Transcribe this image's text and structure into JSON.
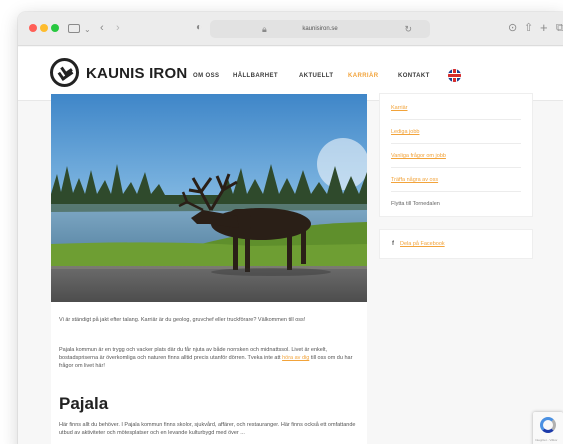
{
  "browser": {
    "url": "kaunisiron.se",
    "icons": [
      "sidebar-icon",
      "back-icon",
      "forward-icon",
      "shield-icon",
      "lock-icon",
      "reload-icon",
      "download-icon",
      "share-icon",
      "new-tab-icon",
      "tabs-icon"
    ]
  },
  "header": {
    "logo_text": "KAUNIS IRON",
    "nav": [
      "OM OSS",
      "HÅLLBARHET",
      "AKTUELLT",
      "KARRIÄR",
      "KONTAKT"
    ],
    "active_nav": "KARRIÄR",
    "language_flag": "UK flag"
  },
  "main": {
    "para1": "Vi är ständigt på jakt efter talang. Karriär är du geolog, gruvchef eller truckförare? Välkommen till oss!",
    "para2_start": "Pajala kommun är en trygg och vacker plats där du får njuta av både norrsken och midnattssol. Livet är enkelt, bostadspriserna är överkomliga och naturen finns alltid precis utanför dörren. Tveka inte att ",
    "para2_link": "höra av dig",
    "para2_end": " till oss om du har frågor om livet här!",
    "section_title": "Pajala",
    "para3": "Här finns allt du behöver. I Pajala kommun finns skolor, sjukvård, affärer, och restauranger. Här finns också ett omfattande utbud av aktiviteter och mötesplatser och en levande kulturbygd med över ..."
  },
  "sidebar": {
    "links": [
      {
        "label": "Karriär",
        "is_link": true
      },
      {
        "label": "Lediga jobb",
        "is_link": true
      },
      {
        "label": "Vanliga frågor om jobb",
        "is_link": true
      },
      {
        "label": "Träffa några av oss",
        "is_link": true
      },
      {
        "label": "Flytta till Tornedalen",
        "is_link": false
      }
    ],
    "facebook_icon": "f",
    "facebook_label": "Dela på Facebook"
  },
  "recaptcha": {
    "text": "Integritet - Villkor"
  },
  "colors": {
    "accent": "#f2a33a",
    "text": "#555555",
    "heading": "#222222"
  }
}
